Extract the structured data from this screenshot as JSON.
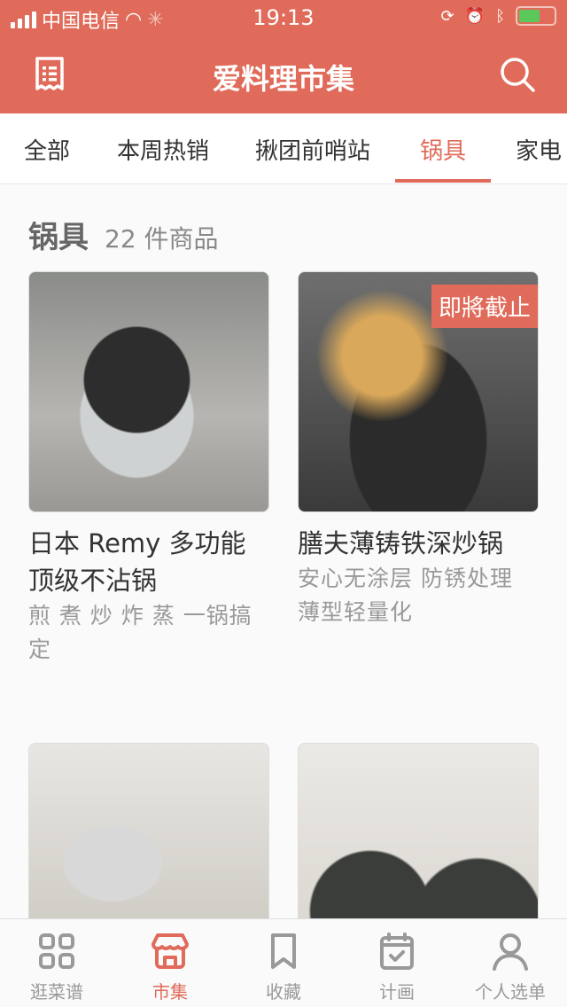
{
  "status": {
    "carrier": "中国电信",
    "time": "19:13"
  },
  "header": {
    "title": "爱料理市集"
  },
  "tabs": [
    {
      "label": "全部"
    },
    {
      "label": "本周热销"
    },
    {
      "label": "揪团前哨站"
    },
    {
      "label": "锅具",
      "active": true
    },
    {
      "label": "家电"
    }
  ],
  "section": {
    "name": "锅具",
    "count": "22 件商品"
  },
  "products": [
    {
      "title": "日本 Remy 多功能顶级不沾锅",
      "subtitle": "煎 煮 炒 炸 蒸 一锅搞定"
    },
    {
      "title": "膳夫薄铸铁深炒锅",
      "subtitle": "安心无涂层 防锈处理 薄型轻量化",
      "badge": "即將截止"
    },
    {
      "title": "",
      "subtitle": ""
    },
    {
      "title": "",
      "subtitle": ""
    }
  ],
  "tabbar": [
    {
      "label": "逛菜谱"
    },
    {
      "label": "市集",
      "active": true
    },
    {
      "label": "收藏"
    },
    {
      "label": "计画"
    },
    {
      "label": "个人选单"
    }
  ],
  "colors": {
    "accent": "#E06B5A"
  }
}
